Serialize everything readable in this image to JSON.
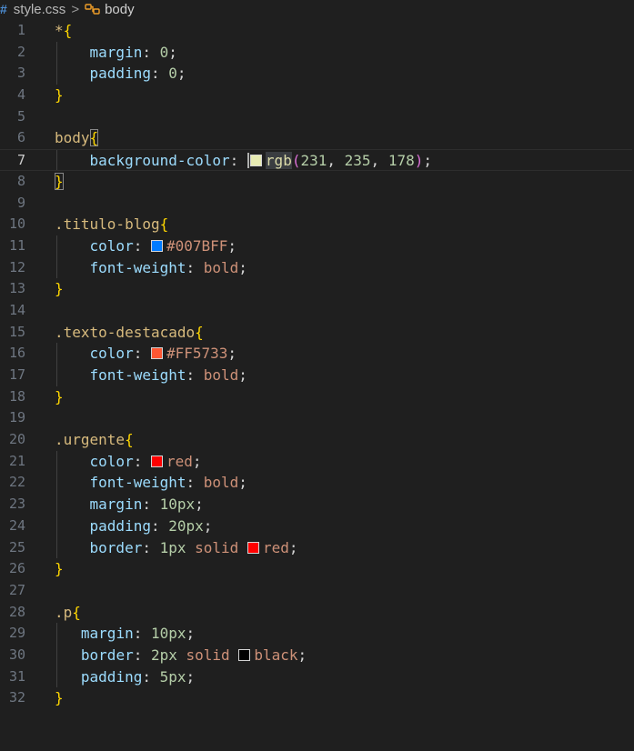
{
  "breadcrumb": {
    "file_icon_glyph": "#",
    "file": "style.css",
    "separator_glyph": ">",
    "symbol": "body"
  },
  "colors": {
    "bg": "#1f1f1f",
    "selector": "#d7ba7d",
    "property": "#9cdcfe",
    "number": "#b5cea8",
    "value": "#ce9178",
    "brace": "#ffd700",
    "function": "#dcdcaa",
    "paren": "#da70d6"
  },
  "editor": {
    "active_line": 7,
    "lines": [
      {
        "n": "1",
        "tokens": [
          [
            "sel",
            "*"
          ],
          [
            "brace",
            "{"
          ]
        ]
      },
      {
        "n": "2",
        "tokens": [
          [
            "indent",
            "    "
          ],
          [
            "prop",
            "margin"
          ],
          [
            "punct",
            ": "
          ],
          [
            "num",
            "0"
          ],
          [
            "punct",
            ";"
          ]
        ]
      },
      {
        "n": "3",
        "tokens": [
          [
            "indent",
            "    "
          ],
          [
            "prop",
            "padding"
          ],
          [
            "punct",
            ": "
          ],
          [
            "num",
            "0"
          ],
          [
            "punct",
            ";"
          ]
        ]
      },
      {
        "n": "4",
        "tokens": [
          [
            "brace",
            "}"
          ]
        ]
      },
      {
        "n": "5",
        "tokens": []
      },
      {
        "n": "6",
        "tokens": [
          [
            "sel",
            "body"
          ],
          [
            "brace-hl",
            "{"
          ]
        ]
      },
      {
        "n": "7",
        "tokens": [
          [
            "indent",
            "    "
          ],
          [
            "prop",
            "background-color"
          ],
          [
            "punct",
            ": "
          ],
          [
            "cursor",
            ""
          ],
          [
            "swatch",
            "#e7ebb2"
          ],
          [
            "fn-hl",
            "rgb"
          ],
          [
            "paren",
            "("
          ],
          [
            "num",
            "231"
          ],
          [
            "punct",
            ", "
          ],
          [
            "num",
            "235"
          ],
          [
            "punct",
            ", "
          ],
          [
            "num",
            "178"
          ],
          [
            "paren",
            ")"
          ],
          [
            "punct",
            ";"
          ]
        ]
      },
      {
        "n": "8",
        "tokens": [
          [
            "brace-hl",
            "}"
          ]
        ]
      },
      {
        "n": "9",
        "tokens": []
      },
      {
        "n": "10",
        "tokens": [
          [
            "sel",
            ".titulo-blog"
          ],
          [
            "brace",
            "{"
          ]
        ]
      },
      {
        "n": "11",
        "tokens": [
          [
            "indent",
            "    "
          ],
          [
            "prop",
            "color"
          ],
          [
            "punct",
            ": "
          ],
          [
            "swatch",
            "#007BFF"
          ],
          [
            "val",
            "#007BFF"
          ],
          [
            "punct",
            ";"
          ]
        ]
      },
      {
        "n": "12",
        "tokens": [
          [
            "indent",
            "    "
          ],
          [
            "prop",
            "font-weight"
          ],
          [
            "punct",
            ": "
          ],
          [
            "val",
            "bold"
          ],
          [
            "punct",
            ";"
          ]
        ]
      },
      {
        "n": "13",
        "tokens": [
          [
            "brace",
            "}"
          ]
        ]
      },
      {
        "n": "14",
        "tokens": []
      },
      {
        "n": "15",
        "tokens": [
          [
            "sel",
            ".texto-destacado"
          ],
          [
            "brace",
            "{"
          ]
        ]
      },
      {
        "n": "16",
        "tokens": [
          [
            "indent",
            "    "
          ],
          [
            "prop",
            "color"
          ],
          [
            "punct",
            ": "
          ],
          [
            "swatch",
            "#FF5733"
          ],
          [
            "val",
            "#FF5733"
          ],
          [
            "punct",
            ";"
          ]
        ]
      },
      {
        "n": "17",
        "tokens": [
          [
            "indent",
            "    "
          ],
          [
            "prop",
            "font-weight"
          ],
          [
            "punct",
            ": "
          ],
          [
            "val",
            "bold"
          ],
          [
            "punct",
            ";"
          ]
        ]
      },
      {
        "n": "18",
        "tokens": [
          [
            "brace",
            "}"
          ]
        ]
      },
      {
        "n": "19",
        "tokens": []
      },
      {
        "n": "20",
        "tokens": [
          [
            "sel",
            ".urgente"
          ],
          [
            "brace",
            "{"
          ]
        ]
      },
      {
        "n": "21",
        "tokens": [
          [
            "indent",
            "    "
          ],
          [
            "prop",
            "color"
          ],
          [
            "punct",
            ": "
          ],
          [
            "swatch",
            "#ff0000"
          ],
          [
            "val",
            "red"
          ],
          [
            "punct",
            ";"
          ]
        ]
      },
      {
        "n": "22",
        "tokens": [
          [
            "indent",
            "    "
          ],
          [
            "prop",
            "font-weight"
          ],
          [
            "punct",
            ": "
          ],
          [
            "val",
            "bold"
          ],
          [
            "punct",
            ";"
          ]
        ]
      },
      {
        "n": "23",
        "tokens": [
          [
            "indent",
            "    "
          ],
          [
            "prop",
            "margin"
          ],
          [
            "punct",
            ": "
          ],
          [
            "num",
            "10px"
          ],
          [
            "punct",
            ";"
          ]
        ]
      },
      {
        "n": "24",
        "tokens": [
          [
            "indent",
            "    "
          ],
          [
            "prop",
            "padding"
          ],
          [
            "punct",
            ": "
          ],
          [
            "num",
            "20px"
          ],
          [
            "punct",
            ";"
          ]
        ]
      },
      {
        "n": "25",
        "tokens": [
          [
            "indent",
            "    "
          ],
          [
            "prop",
            "border"
          ],
          [
            "punct",
            ": "
          ],
          [
            "num",
            "1px"
          ],
          [
            "val",
            " solid "
          ],
          [
            "swatch",
            "#ff0000"
          ],
          [
            "val",
            "red"
          ],
          [
            "punct",
            ";"
          ]
        ]
      },
      {
        "n": "26",
        "tokens": [
          [
            "brace",
            "}"
          ]
        ]
      },
      {
        "n": "27",
        "tokens": []
      },
      {
        "n": "28",
        "tokens": [
          [
            "sel",
            ".p"
          ],
          [
            "brace",
            "{"
          ]
        ]
      },
      {
        "n": "29",
        "tokens": [
          [
            "indent",
            "   "
          ],
          [
            "prop",
            "margin"
          ],
          [
            "punct",
            ": "
          ],
          [
            "num",
            "10px"
          ],
          [
            "punct",
            ";"
          ]
        ]
      },
      {
        "n": "30",
        "tokens": [
          [
            "indent",
            "   "
          ],
          [
            "prop",
            "border"
          ],
          [
            "punct",
            ": "
          ],
          [
            "num",
            "2px"
          ],
          [
            "val",
            " solid "
          ],
          [
            "swatch",
            "#000000"
          ],
          [
            "val",
            "black"
          ],
          [
            "punct",
            ";"
          ]
        ]
      },
      {
        "n": "31",
        "tokens": [
          [
            "indent",
            "   "
          ],
          [
            "prop",
            "padding"
          ],
          [
            "punct",
            ": "
          ],
          [
            "num",
            "5px"
          ],
          [
            "punct",
            ";"
          ]
        ]
      },
      {
        "n": "32",
        "tokens": [
          [
            "brace",
            "}"
          ]
        ]
      }
    ]
  }
}
